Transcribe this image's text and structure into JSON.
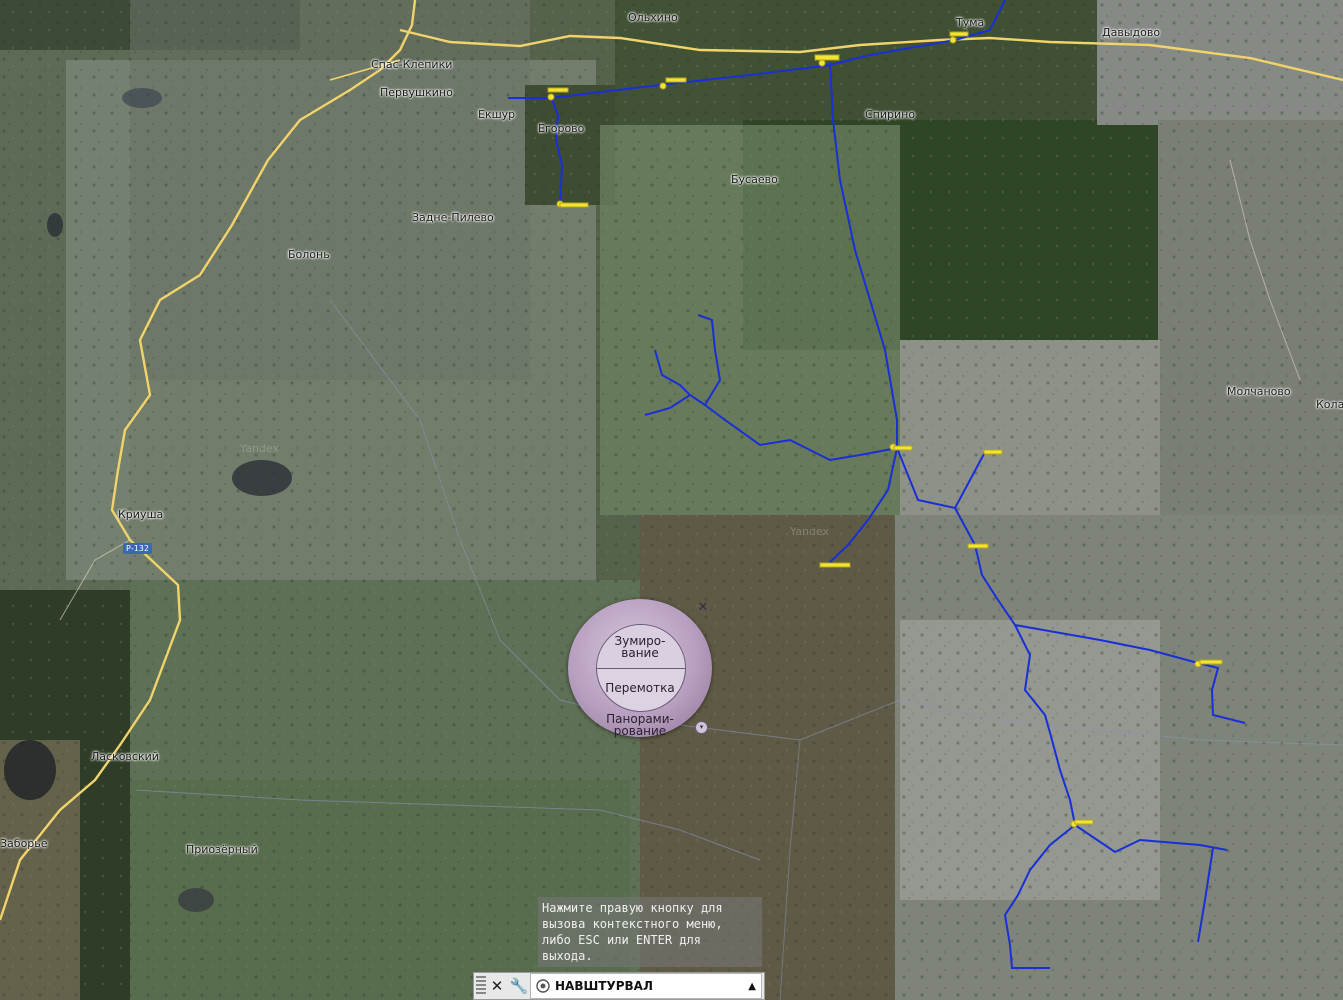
{
  "map": {
    "places": [
      {
        "name": "Спас-Клепики"
      },
      {
        "name": "Первушкино"
      },
      {
        "name": "Екшур"
      },
      {
        "name": "Егорово"
      },
      {
        "name": "Ольхино"
      },
      {
        "name": "Тума"
      },
      {
        "name": "Давыдово"
      },
      {
        "name": "Спирино"
      },
      {
        "name": "Бусаево"
      },
      {
        "name": "Задне-Пилево"
      },
      {
        "name": "Болонь"
      },
      {
        "name": "Криуша"
      },
      {
        "name": "Ласковский"
      },
      {
        "name": "Приозёрный"
      },
      {
        "name": "Заборье"
      },
      {
        "name": "Молчаново"
      },
      {
        "name": "Кола"
      }
    ],
    "road_badge": "Р-132",
    "watermark": "Yandex"
  },
  "nav_wheel": {
    "zoom_label_line1": "Зумиро-",
    "zoom_label_line2": "вание",
    "rewind_label": "Перемотка",
    "pan_label_line1": "Панорами-",
    "pan_label_line2": "рование",
    "close_icon": "✕",
    "menu_icon": "▾"
  },
  "tooltip": {
    "line1": "Нажмите правую кнопку для",
    "line2": "вызова контекстного меню,",
    "line3": "либо ESC или ENTER для",
    "line4": "выхода."
  },
  "command_line": {
    "close_glyph": "✕",
    "settings_glyph": "🔧",
    "value": "НАВШТУРВАЛ",
    "recent_glyph": "▲"
  },
  "colors": {
    "pipeline": "#1a2fd6",
    "road": "#f0d36a",
    "marker": "#f2e531",
    "wheel": "#b79fbf"
  }
}
